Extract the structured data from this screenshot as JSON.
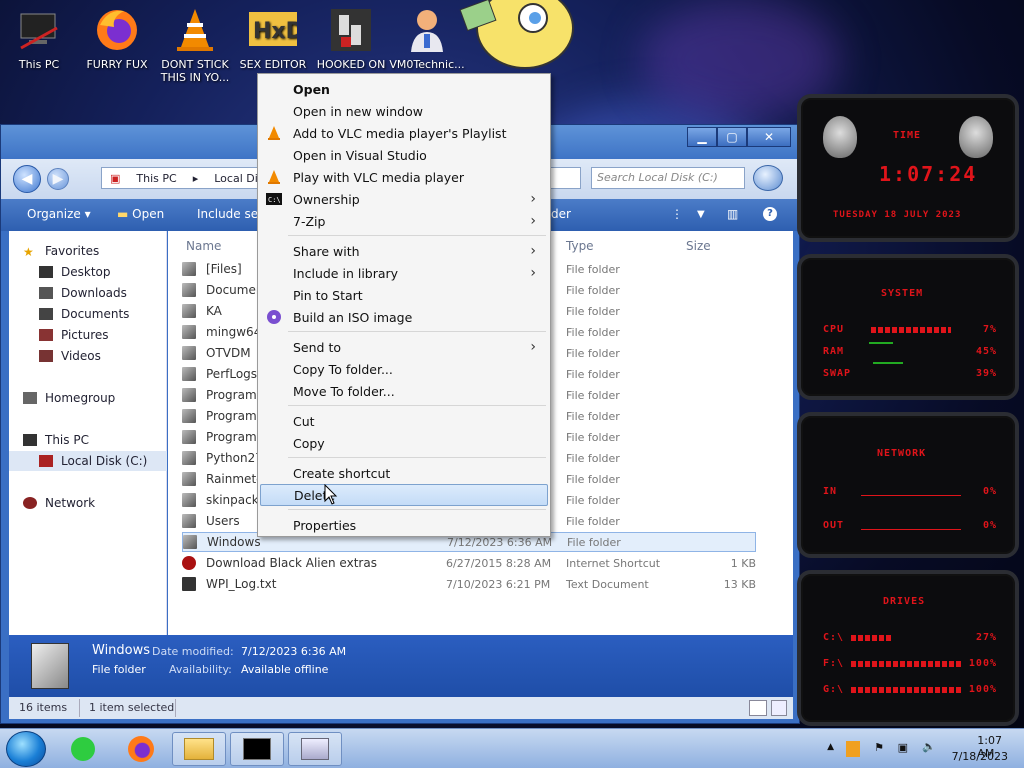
{
  "desktop": {
    "icons": [
      {
        "label": "This PC",
        "icon": "computer-icon"
      },
      {
        "label": "FURRY FUX",
        "icon": "firefox-icon"
      },
      {
        "label": "DONT STICK THIS IN YO...",
        "icon": "vlc-cone-icon"
      },
      {
        "label": "SEX EDITOR",
        "icon": "hxd-editor-icon"
      },
      {
        "label": "HOOKED ON",
        "icon": "game-icon"
      },
      {
        "label": "VM0Technic...",
        "icon": "doctor-icon"
      }
    ]
  },
  "explorer": {
    "address": {
      "crumbs": [
        "This PC",
        "Local Disk"
      ],
      "search_placeholder": "Search Local Disk (C:)"
    },
    "toolbar": {
      "organize": "Organize",
      "open": "Open",
      "include": "Include sele",
      "new_folder": "der"
    },
    "nav": {
      "favorites": "Favorites",
      "fav_items": [
        "Desktop",
        "Downloads",
        "Documents",
        "Pictures",
        "Videos"
      ],
      "homegroup": "Homegroup",
      "this_pc": "This PC",
      "local_disk": "Local Disk (C:)",
      "network": "Network"
    },
    "columns": {
      "name": "Name",
      "type": "Type",
      "size": "Size"
    },
    "files": [
      {
        "name": "[Files]",
        "date": "",
        "type": "File folder",
        "size": ""
      },
      {
        "name": "Document",
        "date": "",
        "type": "File folder",
        "size": ""
      },
      {
        "name": "KA",
        "date": "",
        "type": "File folder",
        "size": ""
      },
      {
        "name": "mingw64",
        "date": "",
        "type": "File folder",
        "size": ""
      },
      {
        "name": "OTVDM",
        "date": "",
        "type": "File folder",
        "size": ""
      },
      {
        "name": "PerfLogs",
        "date": "",
        "type": "File folder",
        "size": ""
      },
      {
        "name": "Program F",
        "date": "",
        "type": "File folder",
        "size": ""
      },
      {
        "name": "Program F",
        "date": "",
        "type": "File folder",
        "size": ""
      },
      {
        "name": "ProgramD",
        "date": "",
        "type": "File folder",
        "size": ""
      },
      {
        "name": "Python27",
        "date": "",
        "type": "File folder",
        "size": ""
      },
      {
        "name": "Rainmeter",
        "date": "",
        "type": "File folder",
        "size": ""
      },
      {
        "name": "skinpack",
        "date": "",
        "type": "File folder",
        "size": ""
      },
      {
        "name": "Users",
        "date": "",
        "type": "File folder",
        "size": ""
      },
      {
        "name": "Windows",
        "date": "7/12/2023 6:36 AM",
        "type": "File folder",
        "size": "",
        "selected": true
      },
      {
        "name": "Download Black Alien extras",
        "date": "6/27/2015 8:28 AM",
        "type": "Internet Shortcut",
        "size": "1 KB"
      },
      {
        "name": "WPI_Log.txt",
        "date": "7/10/2023 6:21 PM",
        "type": "Text Document",
        "size": "13 KB"
      }
    ],
    "details": {
      "name": "Windows",
      "kind": "File folder",
      "modified_label": "Date modified:",
      "modified_value": "7/12/2023 6:36 AM",
      "availability_label": "Availability:",
      "availability_value": "Available offline"
    },
    "status": {
      "count": "16 items",
      "selected": "1 item selected"
    }
  },
  "context_menu": {
    "items": [
      {
        "label": "Open",
        "bold": true
      },
      {
        "label": "Open in new window"
      },
      {
        "label": "Add to VLC media player's Playlist",
        "icon": "vlc-cone-icon"
      },
      {
        "label": "Open in Visual Studio"
      },
      {
        "label": "Play with VLC media player",
        "icon": "vlc-cone-icon"
      },
      {
        "label": "Ownership",
        "icon": "cmd-icon",
        "submenu": true
      },
      {
        "label": "7-Zip",
        "submenu": true
      },
      {
        "label": "Share with",
        "submenu": true
      },
      {
        "label": "Include in library",
        "submenu": true
      },
      {
        "label": "Pin to Start"
      },
      {
        "label": "Build an ISO image",
        "icon": "iso-icon"
      },
      {
        "label": "Send to",
        "submenu": true
      },
      {
        "label": "Copy To folder..."
      },
      {
        "label": "Move To folder..."
      },
      {
        "label": "Cut"
      },
      {
        "label": "Copy"
      },
      {
        "label": "Create shortcut"
      },
      {
        "label": "Delete",
        "highlighted": true
      },
      {
        "label": "Properties"
      }
    ]
  },
  "rainmeter": {
    "time_title": "TIME",
    "time": "1:07:24",
    "date": "TUESDAY 18 JULY 2023",
    "system_title": "SYSTEM",
    "cpu_label": "CPU",
    "cpu_value": "7%",
    "ram_label": "RAM",
    "ram_value": "45%",
    "swap_label": "SWAP",
    "swap_value": "39%",
    "network_title": "NETWORK",
    "in_label": "IN",
    "in_value": "0%",
    "out_label": "OUT",
    "out_value": "0%",
    "drives_title": "DRIVES",
    "drive_c_label": "C:\\",
    "drive_c_value": "27%",
    "drive_f_label": "F:\\",
    "drive_f_value": "100%",
    "drive_g_label": "G:\\",
    "drive_g_value": "100%"
  },
  "taskbar": {
    "time": "1:07 AM",
    "date": "7/18/2023"
  },
  "colors": {
    "accent": "#e0141a",
    "selection": "#c4dcf7"
  }
}
